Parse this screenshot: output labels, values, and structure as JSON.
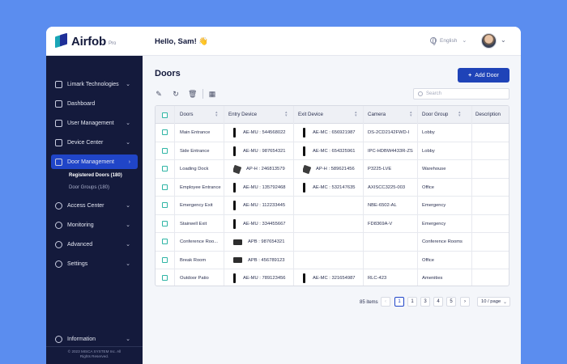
{
  "app": {
    "name": "Airfob",
    "edition": "Pro"
  },
  "header": {
    "greeting": "Hello, Sam! 👋",
    "language": "English"
  },
  "sidebar": {
    "items": [
      {
        "label": "Limark Technologies",
        "icon": "building-icon"
      },
      {
        "label": "Dashboard",
        "icon": "dashboard-icon"
      },
      {
        "label": "User Management",
        "icon": "user-icon"
      },
      {
        "label": "Device Center",
        "icon": "device-icon"
      },
      {
        "label": "Door Management",
        "icon": "door-icon"
      },
      {
        "label": "Access Center",
        "icon": "key-icon"
      },
      {
        "label": "Monitoring",
        "icon": "monitor-icon"
      },
      {
        "label": "Advanced",
        "icon": "gear-icon"
      },
      {
        "label": "Settings",
        "icon": "settings-icon"
      },
      {
        "label": "Information",
        "icon": "info-icon"
      }
    ],
    "sub_items": [
      {
        "label": "Registered Doors  (180)"
      },
      {
        "label": "Door Groups  (180)"
      }
    ],
    "copyright_line1": "© 2023 MISCA SYSTEM Inc. All",
    "copyright_line2": "Rights Reserved."
  },
  "main": {
    "title": "Doors",
    "add_button": "Add Door",
    "search_placeholder": "Search",
    "toolbar": [
      "edit-icon",
      "refresh-icon",
      "delete-icon",
      "calendar-icon"
    ]
  },
  "table": {
    "columns": [
      "Doors",
      "Entry Device",
      "Exit Device",
      "Camera",
      "Door Group",
      "Description"
    ],
    "rows": [
      {
        "door": "Main Entrance",
        "entry": "AE-MU : 544568022",
        "entry_icon": "bar",
        "exit": "AE-MC : 656921987",
        "exit_icon": "bar",
        "camera": "DS-2CD2142FWD-I",
        "group": "Lobby",
        "desc": ""
      },
      {
        "door": "Side Entrance",
        "entry": "AE-MU : 987654321",
        "entry_icon": "bar",
        "exit": "AE-MC : 654325961",
        "exit_icon": "bar",
        "camera": "IPC-HDBW4433R-ZS",
        "group": "Lobby",
        "desc": ""
      },
      {
        "door": "Loading Dock",
        "entry": "AP-H : 246813579",
        "entry_icon": "square",
        "exit": "AP-H : 589621456",
        "exit_icon": "square",
        "camera": "P3225-LVE",
        "group": "Warehouse",
        "desc": ""
      },
      {
        "door": "Employee Entrance",
        "entry": "AE-MU : 135792468",
        "entry_icon": "bar",
        "exit": "AE-MC : 532147635",
        "exit_icon": "bar",
        "camera": "AXISCC3225-003",
        "group": "Office",
        "desc": ""
      },
      {
        "door": "Emergency Exit",
        "entry": "AE-MU : 112233445",
        "entry_icon": "bar",
        "exit": "",
        "exit_icon": "",
        "camera": "NBE-6502-AL",
        "group": "Emergency",
        "desc": ""
      },
      {
        "door": "Stairwell Exit",
        "entry": "AE-MU : 334455667",
        "entry_icon": "bar",
        "exit": "",
        "exit_icon": "",
        "camera": "FD8369A-V",
        "group": "Emergency",
        "desc": ""
      },
      {
        "door": "Conference Roo...",
        "entry": "APB : 987654321",
        "entry_icon": "wide",
        "exit": "",
        "exit_icon": "",
        "camera": "",
        "group": "Conference Rooms",
        "desc": ""
      },
      {
        "door": "Break Room",
        "entry": "APB : 456789123",
        "entry_icon": "wide",
        "exit": "",
        "exit_icon": "",
        "camera": "",
        "group": "Office",
        "desc": ""
      },
      {
        "door": "Outdoor Patio",
        "entry": "AE-MU : 789123456",
        "entry_icon": "bar",
        "exit": "AE-MC : 321654987",
        "exit_icon": "bar",
        "camera": "RLC-423",
        "group": "Amenities",
        "desc": ""
      }
    ]
  },
  "pagination": {
    "total": "85 items",
    "prev": "‹",
    "next": "›",
    "pages": [
      "1",
      "1",
      "3",
      "4",
      "5"
    ],
    "current": 1,
    "page_size": "10 / page"
  },
  "colors": {
    "brand": "#1f43b8",
    "sidebar": "#141a3c",
    "background": "#5b8def",
    "checkbox": "#2fb5a5"
  }
}
